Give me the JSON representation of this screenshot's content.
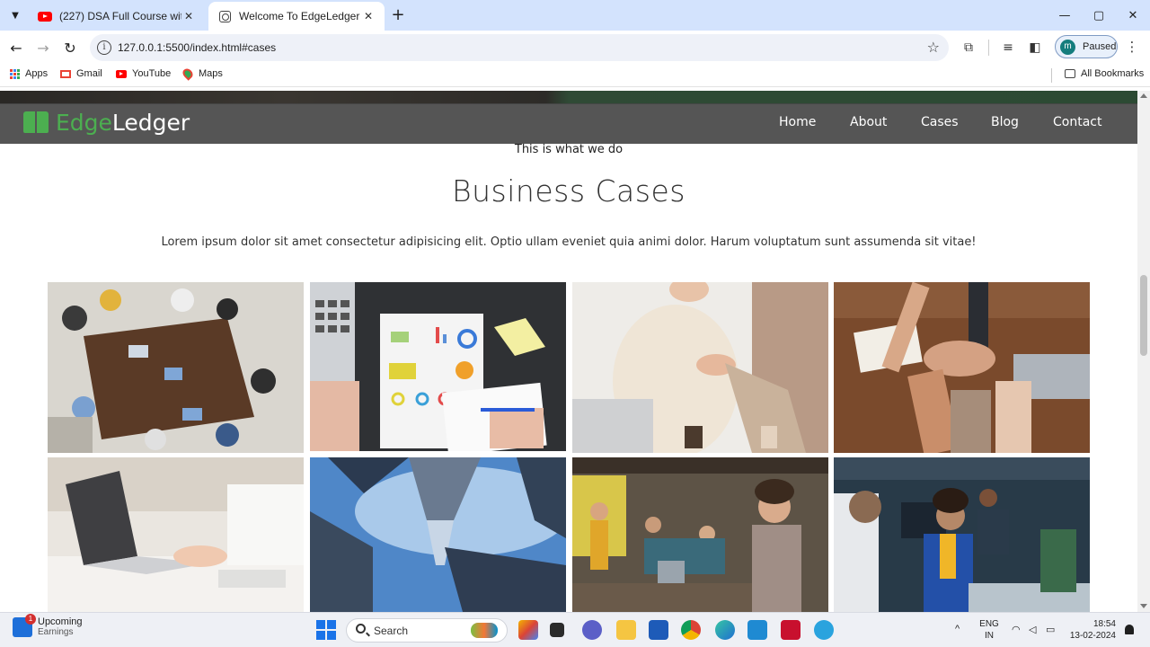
{
  "browser": {
    "tabs": [
      {
        "title": "(227) DSA Full Course with Prac",
        "active": false,
        "icon": "youtube-icon"
      },
      {
        "title": "Welcome To EdgeLedger",
        "active": true,
        "icon": "globe-icon"
      }
    ],
    "new_tab": "+",
    "window_controls": {
      "minimize": "—",
      "maximize": "▢",
      "close": "✕"
    },
    "url": "127.0.0.1:5500/index.html#cases",
    "profile": {
      "initial": "m",
      "status": "Paused"
    },
    "bookmarks": [
      {
        "label": "Apps",
        "icon": "apps-icon"
      },
      {
        "label": "Gmail",
        "icon": "gmail-icon"
      },
      {
        "label": "YouTube",
        "icon": "youtube-icon"
      },
      {
        "label": "Maps",
        "icon": "maps-icon"
      }
    ],
    "all_bookmarks": "All Bookmarks"
  },
  "site": {
    "brand": {
      "part1": "Edge",
      "part2": "Ledger"
    },
    "nav": [
      "Home",
      "About",
      "Cases",
      "Blog",
      "Contact"
    ],
    "kicker": "This is what we do",
    "heading": "Business Cases",
    "lead": "Lorem ipsum dolor sit amet consectetur adipisicing elit. Optio ullam eveniet quia animi dolor. Harum voluptatum sunt assumenda sit vitae!",
    "case_images": [
      "team-meeting-overhead-photo",
      "financial-charts-desk-photo",
      "handshake-photo",
      "hands-stacked-teamwork-photo",
      "laptop-typing-photo",
      "skyscrapers-lookup-photo",
      "smiling-woman-office-photo",
      "smiling-woman-coworkers-photo"
    ],
    "colors": {
      "brand_green": "#4caf50",
      "navbar": "#464646",
      "text": "#333333"
    }
  },
  "taskbar": {
    "weather": {
      "title": "Upcoming",
      "subtitle": "Earnings",
      "badge": "1"
    },
    "search": "Search",
    "language": {
      "line1": "ENG",
      "line2": "IN"
    },
    "time": "18:54",
    "date": "13-02-2024"
  }
}
